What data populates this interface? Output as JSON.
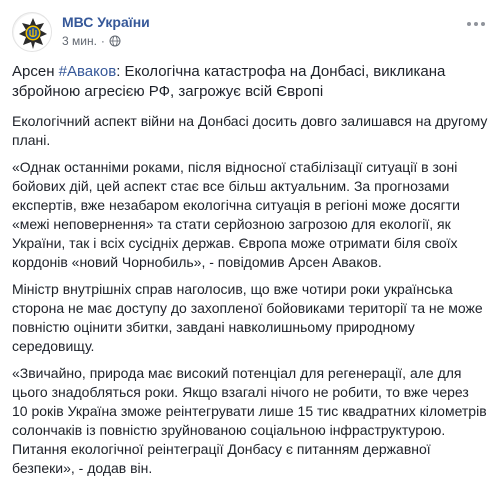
{
  "header": {
    "page_name": "МВС України",
    "timestamp": "3 мин.",
    "separator": "·",
    "privacy_icon": "globe-icon",
    "more_icon": "more-options-icon"
  },
  "post": {
    "headline_prefix": "Арсен ",
    "hashtag": "#Аваков",
    "headline_suffix": ": Екологічна катастрофа на Донбасі, викликана збройною агресією РФ, загрожує всій Європі",
    "paragraphs": [
      "Екологічний аспект війни на Донбасі досить довго залишався на другому плані.",
      "«Однак останніми роками, після відносної стабілізації ситуації в зоні бойових дій, цей аспект стає все більш актуальним. За прогнозами експертів, вже незабаром екологічна ситуація в регіоні може досягти «межі неповернення» та стати серйозною загрозою для екології, як України, так і всіх сусідніх держав. Європа може отримати біля своїх кордонів «новий Чорнобиль», - повідомив Арсен Аваков.",
      "Міністр внутрішніх справ наголосив, що вже чотири роки українська сторона не має доступу до захопленої бойовиками території та не може повністю оцінити збитки, завдані навколишньому природному середовищу.",
      "«Звичайно, природа має високий потенціал для регенерації, але для цього знадобляться роки. Якщо взагалі нічого не робити, то вже через 10 років Україна зможе реінтегрувати лише 15 тис квадратних кілометрів солончаків із повністю зруйнованою соціальною інфраструктурою. Питання екологічної реінтеграції Донбасу є питанням державної безпеки», - додав він."
    ]
  },
  "colors": {
    "link": "#365899",
    "text": "#1d2129",
    "meta": "#616770"
  }
}
